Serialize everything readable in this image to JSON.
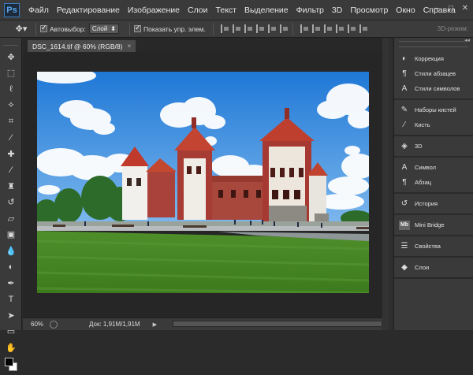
{
  "app": {
    "logo": "Ps",
    "menu": [
      "Файл",
      "Редактирование",
      "Изображение",
      "Слои",
      "Текст",
      "Выделение",
      "Фильтр",
      "3D",
      "Просмотр",
      "Окно",
      "Справка"
    ],
    "window_controls": [
      "–",
      "□",
      "✕"
    ]
  },
  "options_bar": {
    "autoselect_label": "Автовыбор:",
    "autoselect_value": "Слой",
    "show_transform_label": "Показать упр. элем.",
    "mode3d_label": "3D-режим:"
  },
  "tools": [
    {
      "name": "move-tool",
      "icon": "✥"
    },
    {
      "name": "marquee-tool",
      "icon": "⬚"
    },
    {
      "name": "lasso-tool",
      "icon": "ℓ"
    },
    {
      "name": "quick-select-tool",
      "icon": "⟡"
    },
    {
      "name": "crop-tool",
      "icon": "⌗"
    },
    {
      "name": "eyedropper-tool",
      "icon": "⁄"
    },
    {
      "name": "healing-brush-tool",
      "icon": "✚"
    },
    {
      "name": "brush-tool",
      "icon": "∕"
    },
    {
      "name": "clone-stamp-tool",
      "icon": "♜"
    },
    {
      "name": "history-brush-tool",
      "icon": "↺"
    },
    {
      "name": "eraser-tool",
      "icon": "▱"
    },
    {
      "name": "gradient-tool",
      "icon": "▣"
    },
    {
      "name": "blur-tool",
      "icon": "💧"
    },
    {
      "name": "dodge-tool",
      "icon": "◐"
    },
    {
      "name": "pen-tool",
      "icon": "✒"
    },
    {
      "name": "type-tool",
      "icon": "T"
    },
    {
      "name": "path-select-tool",
      "icon": "➤"
    },
    {
      "name": "shape-tool",
      "icon": "▭"
    },
    {
      "name": "hand-tool",
      "icon": "✋"
    }
  ],
  "document": {
    "tab_title": "DSC_1614.tif @ 60% (RGB/8)",
    "tab_close": "×",
    "zoom": "60%",
    "doc_size": "Док: 1,91M/1,91M",
    "status_arrow": "▶"
  },
  "panels": {
    "collapse_arrows": "◂◂",
    "groups": [
      [
        {
          "label": "Коррекция",
          "icon": "◐"
        },
        {
          "label": "Стили абзацев",
          "icon": "¶"
        },
        {
          "label": "Стили символов",
          "icon": "A"
        }
      ],
      [
        {
          "label": "Наборы кистей",
          "icon": "✎"
        },
        {
          "label": "Кисть",
          "icon": "∕"
        }
      ],
      [
        {
          "label": "3D",
          "icon": "◈"
        }
      ],
      [
        {
          "label": "Символ",
          "icon": "A"
        },
        {
          "label": "Абзац",
          "icon": "¶"
        }
      ],
      [
        {
          "label": "История",
          "icon": "↺"
        }
      ],
      [
        {
          "label": "Mini Bridge",
          "icon": "Mb"
        }
      ],
      [
        {
          "label": "Свойства",
          "icon": "☰"
        }
      ],
      [
        {
          "label": "Слои",
          "icon": "◆"
        }
      ]
    ]
  }
}
